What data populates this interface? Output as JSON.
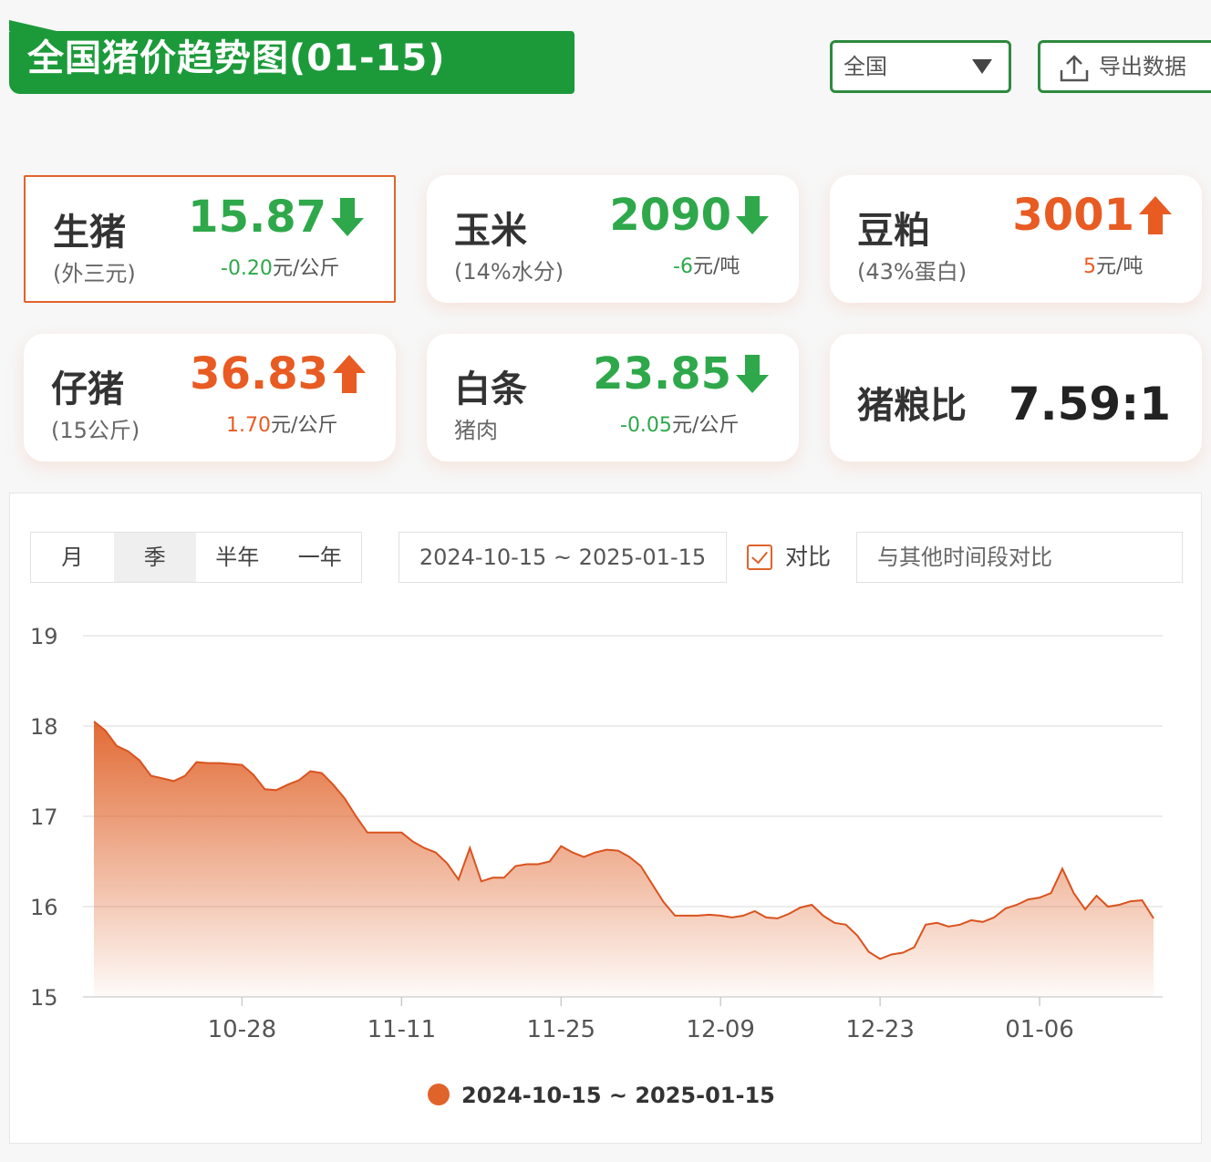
{
  "header": {
    "title": "全国猪价趋势图(01-15)",
    "region_select": "全国",
    "export_label": "导出数据"
  },
  "cards": [
    {
      "name": "生猪",
      "sub": "(外三元)",
      "price": "15.87",
      "dir": "down",
      "change": "-0.20",
      "unit": "元/公斤"
    },
    {
      "name": "玉米",
      "sub": "(14%水分)",
      "price": "2090",
      "dir": "down",
      "change": "-6",
      "unit": "元/吨"
    },
    {
      "name": "豆粕",
      "sub": "(43%蛋白)",
      "price": "3001",
      "dir": "up",
      "change": "5",
      "unit": "元/吨"
    },
    {
      "name": "仔猪",
      "sub": "(15公斤)",
      "price": "36.83",
      "dir": "up",
      "change": "1.70",
      "unit": "元/公斤"
    },
    {
      "name": "白条",
      "sub": "猪肉",
      "price": "23.85",
      "dir": "down",
      "change": "-0.05",
      "unit": "元/公斤"
    },
    {
      "name": "猪粮比",
      "ratio": "7.59:1"
    }
  ],
  "controls": {
    "tabs": [
      "月",
      "季",
      "半年",
      "一年"
    ],
    "active_tab": "季",
    "date_range": "2024-10-15 ~ 2025-01-15",
    "compare_label": "对比",
    "compare_placeholder": "与其他时间段对比"
  },
  "colors": {
    "up": "#e85b22",
    "down": "#2ea84a",
    "brand": "#1c9a3a",
    "series": "#e0632a"
  },
  "icons": {
    "down": "arrow-down-icon",
    "up": "arrow-up-icon",
    "export": "upload-icon",
    "select": "caret-down-icon",
    "compare": "checkbox-icon"
  },
  "chart_data": {
    "type": "area",
    "ylim": [
      15,
      19
    ],
    "yticks": [
      15,
      16,
      17,
      18,
      19
    ],
    "x_ticks": [
      "10-28",
      "11-11",
      "11-25",
      "12-09",
      "12-23",
      "01-06"
    ],
    "x_tick_index": [
      13,
      27,
      41,
      55,
      69,
      83
    ],
    "grid": true,
    "legend_position": "bottom",
    "series": [
      {
        "name": "2024-10-15 ~ 2025-01-15",
        "values": [
          18.05,
          17.95,
          17.78,
          17.72,
          17.62,
          17.45,
          17.42,
          17.39,
          17.45,
          17.6,
          17.59,
          17.59,
          17.58,
          17.57,
          17.46,
          17.3,
          17.29,
          17.35,
          17.4,
          17.5,
          17.48,
          17.35,
          17.2,
          17.0,
          16.82,
          16.82,
          16.82,
          16.82,
          16.72,
          16.65,
          16.6,
          16.48,
          16.3,
          16.65,
          16.28,
          16.32,
          16.32,
          16.45,
          16.47,
          16.47,
          16.5,
          16.67,
          16.6,
          16.55,
          16.6,
          16.63,
          16.62,
          16.55,
          16.45,
          16.25,
          16.05,
          15.9,
          15.9,
          15.9,
          15.91,
          15.9,
          15.88,
          15.9,
          15.95,
          15.88,
          15.87,
          15.92,
          15.99,
          16.02,
          15.9,
          15.82,
          15.8,
          15.68,
          15.5,
          15.42,
          15.47,
          15.49,
          15.55,
          15.8,
          15.82,
          15.78,
          15.8,
          15.85,
          15.83,
          15.88,
          15.98,
          16.02,
          16.08,
          16.1,
          16.15,
          16.42,
          16.15,
          15.97,
          16.12,
          16.0,
          16.02,
          16.06,
          16.07,
          15.87
        ]
      }
    ]
  }
}
